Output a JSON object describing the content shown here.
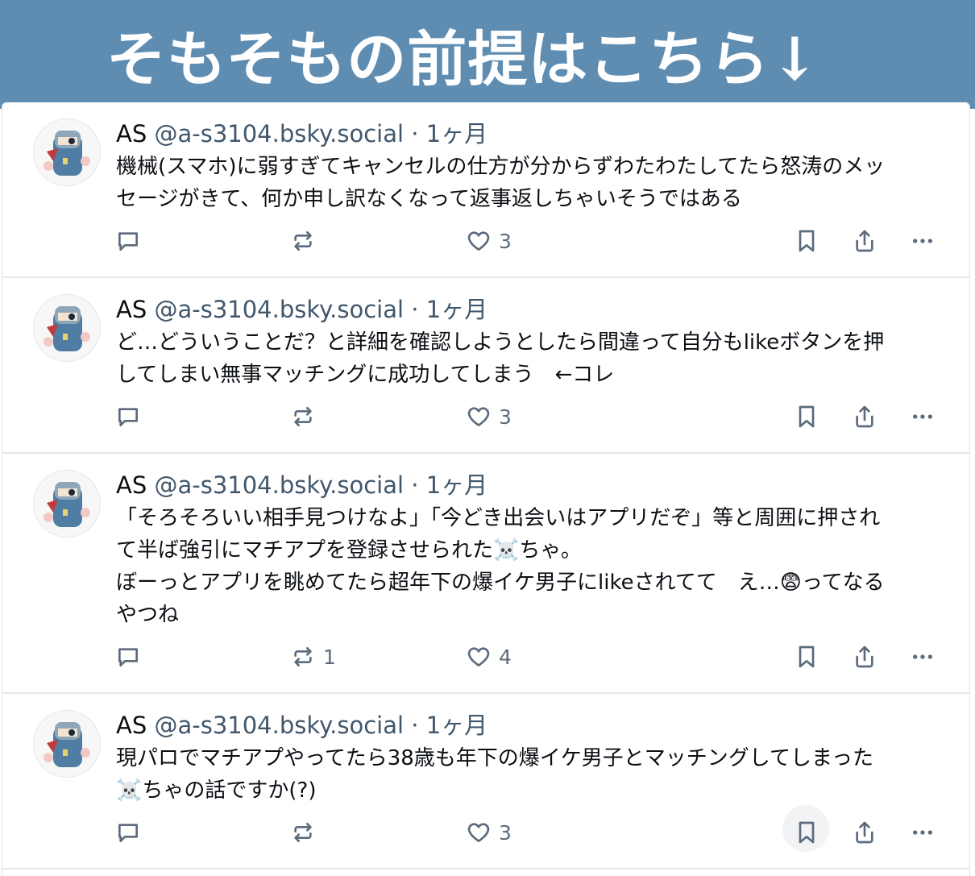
{
  "banner": {
    "title": "そもそもの前提はこちら↓"
  },
  "posts": [
    {
      "handle": "@a-s3104.bsky.social",
      "display_name": "AS",
      "time": "1ヶ月",
      "text": "機械(スマホ)に弱すぎてキャンセルの仕方が分からずわたわたしてたら怒涛のメッ\nセージがきて、何か申し訳なくなって返事返しちゃいそうではある",
      "replies": "",
      "reposts": "",
      "likes": "3"
    },
    {
      "handle": "@a-s3104.bsky.social",
      "display_name": "AS",
      "time": "1ヶ月",
      "text": "ど…どういうことだ？と詳細を確認しようとしたら間違って自分もlikeボタンを押\nしてしまい無事マッチングに成功してしまう　←コレ",
      "replies": "",
      "reposts": "",
      "likes": "3"
    },
    {
      "handle": "@a-s3104.bsky.social",
      "display_name": "AS",
      "time": "1ヶ月",
      "text": "「そろそろいい相手見つけなよ」「今どき出会いはアプリだぞ」等と周囲に押され\nて半ば強引にマチアプを登録させられた☠️ちゃ。\nぼーっとアプリを眺めてたら超年下の爆イケ男子にlikeされてて　え…😨ってなる\nやつね",
      "replies": "",
      "reposts": "1",
      "likes": "4"
    },
    {
      "handle": "@a-s3104.bsky.social",
      "display_name": "AS",
      "time": "1ヶ月",
      "text": "現パロでマチアプやってたら38歳も年下の爆イケ男子とマッチングしてしまった\n☠️ちゃの話ですか(?)",
      "replies": "",
      "reposts": "",
      "likes": "3"
    }
  ],
  "colors": {
    "banner": "#5f8db2",
    "icon": "#5b6b7d",
    "meta": "#42576c"
  }
}
